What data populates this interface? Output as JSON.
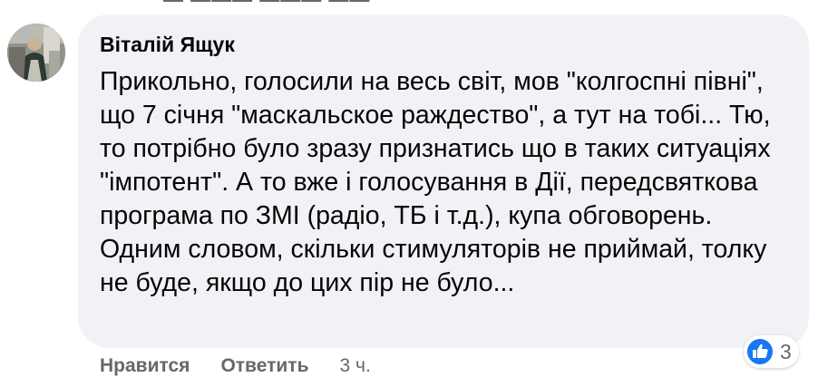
{
  "comment": {
    "author": "Віталій Ящук",
    "text": "Прикольно, голосили на весь світ, мов \"колгоспні півні\", що 7 січня \"маскальское раждество\", а тут на тобі... Тю, то потрібно було зразу признатись що в таких ситуаціях \"імпотент\". А то вже і голосування в Дії, передсвяткова програма по ЗМІ (радіо, ТБ і т.д.), купа обговорень. Одним словом, скільки стимуляторів не приймай, толку не буде, якщо до цих пір не було...",
    "avatar_icon": "user-avatar-photo"
  },
  "reactions": {
    "icon": "like-icon",
    "count": "3",
    "color": "#1877f2"
  },
  "actions": {
    "like_label": "Нравится",
    "reply_label": "Ответить",
    "timestamp": "3 ч."
  },
  "colors": {
    "bubble": "#f0f2f5",
    "text": "#050505",
    "secondary": "#65676b"
  }
}
